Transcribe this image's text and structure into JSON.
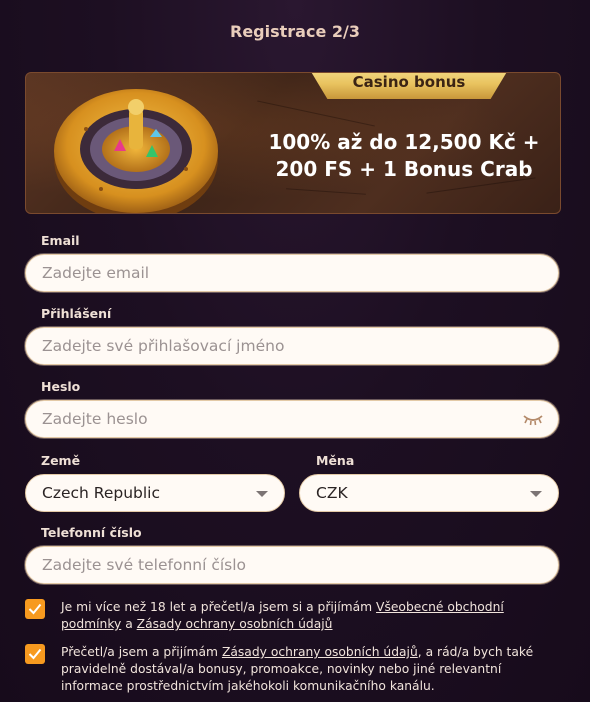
{
  "header": {
    "title": "Registrace 2/3"
  },
  "bonus": {
    "tag": "Casino bonus",
    "line1": "100% až do 12,500 Kč +",
    "line2": "200 FS + 1 Bonus Crab"
  },
  "form": {
    "email": {
      "label": "Email",
      "placeholder": "Zadejte email"
    },
    "login": {
      "label": "Přihlášení",
      "placeholder": "Zadejte své přihlašovací jméno"
    },
    "password": {
      "label": "Heslo",
      "placeholder": "Zadejte heslo"
    },
    "country": {
      "label": "Země",
      "value": "Czech Republic"
    },
    "currency": {
      "label": "Měna",
      "value": "CZK"
    },
    "phone": {
      "label": "Telefonní číslo",
      "placeholder": "Zadejte své telefonní číslo"
    }
  },
  "consents": {
    "age": {
      "text_before": "Je mi více než 18 let a přečetl/a jsem si a přijímám ",
      "link1": "Všeobecné obchodní podmínky",
      "text_mid": " a ",
      "link2": "Zásady ochrany osobních údajů",
      "checked": true
    },
    "marketing": {
      "text_before": "Přečetl/a jsem a přijímám ",
      "link": "Zásady ochrany osobních údajů",
      "text_after": ", a rád/a bych také pravidelně dostával/a bonusy, promoakce, novinky nebo jiné relevantní informace prostřednictvím jakéhokoli komunikačního kanálu.",
      "checked": true
    }
  },
  "colors": {
    "accent": "#f79a1f",
    "tag_gold": "#e9c35f",
    "background": "#1d0f22"
  },
  "icons": {
    "checkbox": "check-icon",
    "password_toggle": "closed-eye-icon",
    "dropdown": "caret-down-icon"
  }
}
